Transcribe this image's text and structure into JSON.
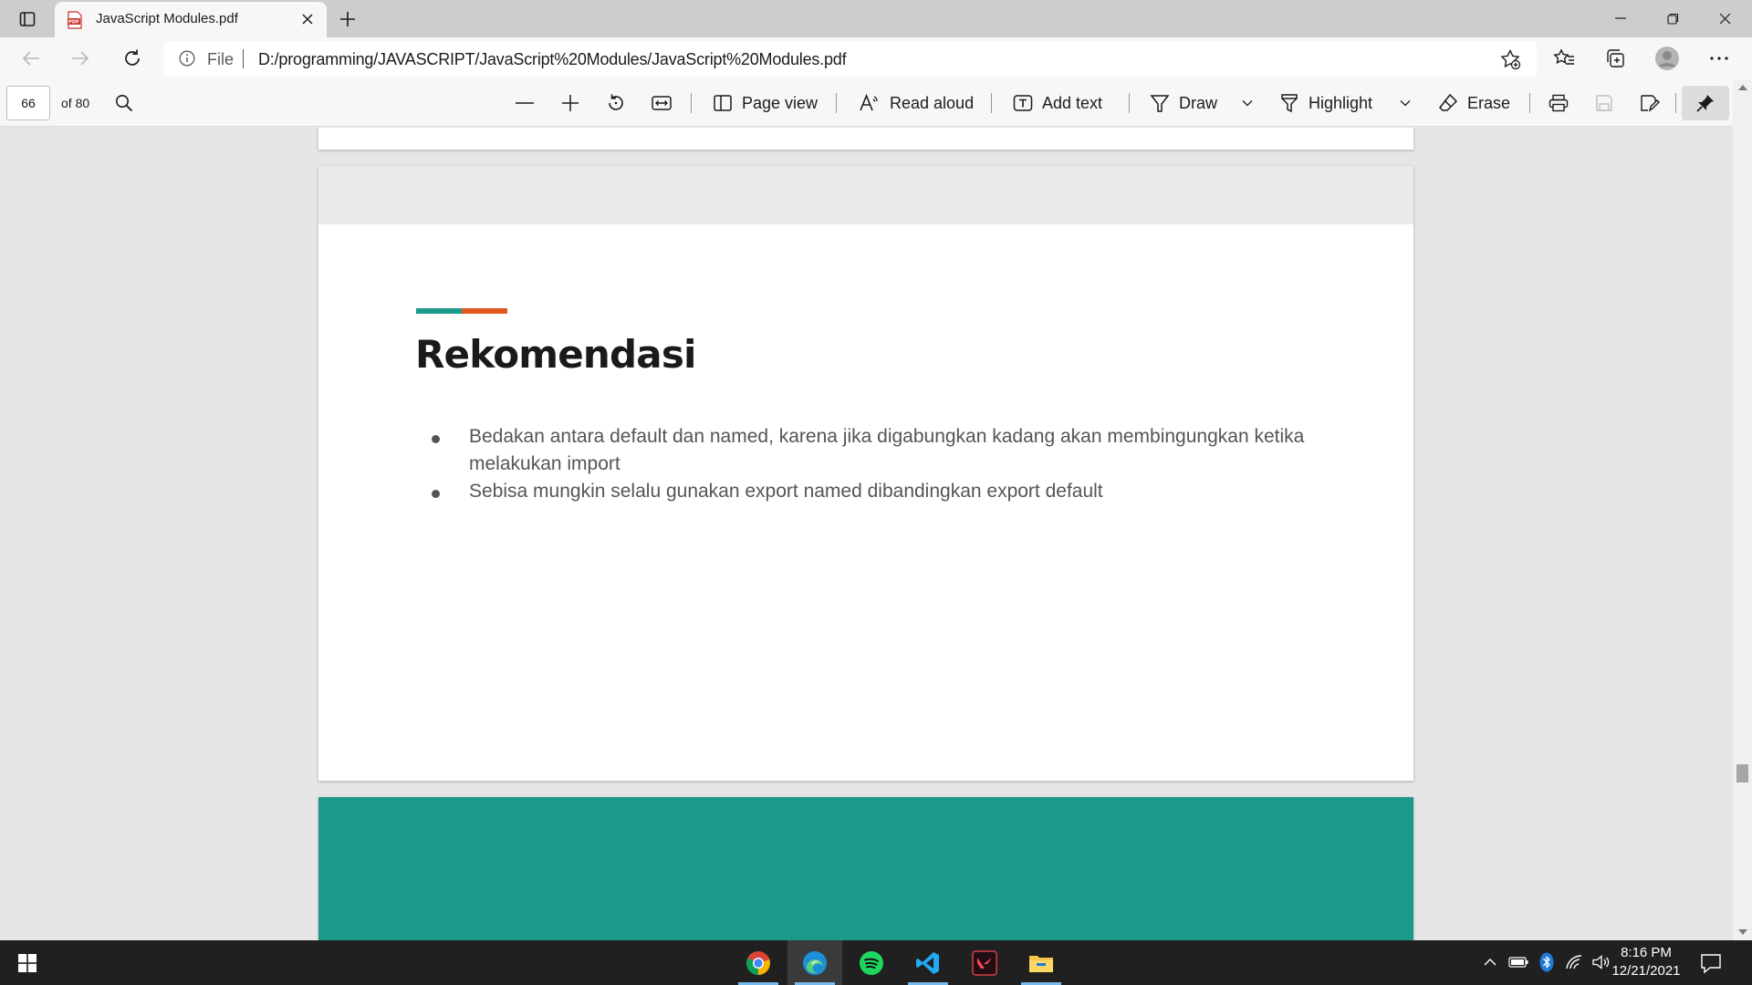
{
  "browser": {
    "tab": {
      "title": "JavaScript Modules.pdf",
      "favicon_text": "PDF"
    },
    "address": {
      "scheme_label": "File",
      "url": "D:/programming/JAVASCRIPT/JavaScript%20Modules/JavaScript%20Modules.pdf"
    }
  },
  "pdf_toolbar": {
    "page_current": "66",
    "page_total": "of 80",
    "page_view": "Page view",
    "read_aloud": "Read aloud",
    "add_text": "Add text",
    "draw": "Draw",
    "highlight": "Highlight",
    "erase": "Erase"
  },
  "slide": {
    "title": "Rekomendasi",
    "accent_colors": [
      "#1b9a8b",
      "#e2571e"
    ],
    "header_color": "#e8eaeb",
    "bullets": [
      "Bedakan antara default dan named, karena jika digabungkan kadang akan membingungkan ketika melakukan import",
      "Sebisa mungkin selalu gunakan export named dibandingkan export default"
    ],
    "next_slide_color": "#1b9a8b"
  },
  "taskbar": {
    "apps": [
      "chrome-icon",
      "edge-icon",
      "spotify-icon",
      "vscode-icon",
      "valorant-icon",
      "file-explorer-icon"
    ],
    "time": "8:16 PM",
    "date": "12/21/2021"
  }
}
